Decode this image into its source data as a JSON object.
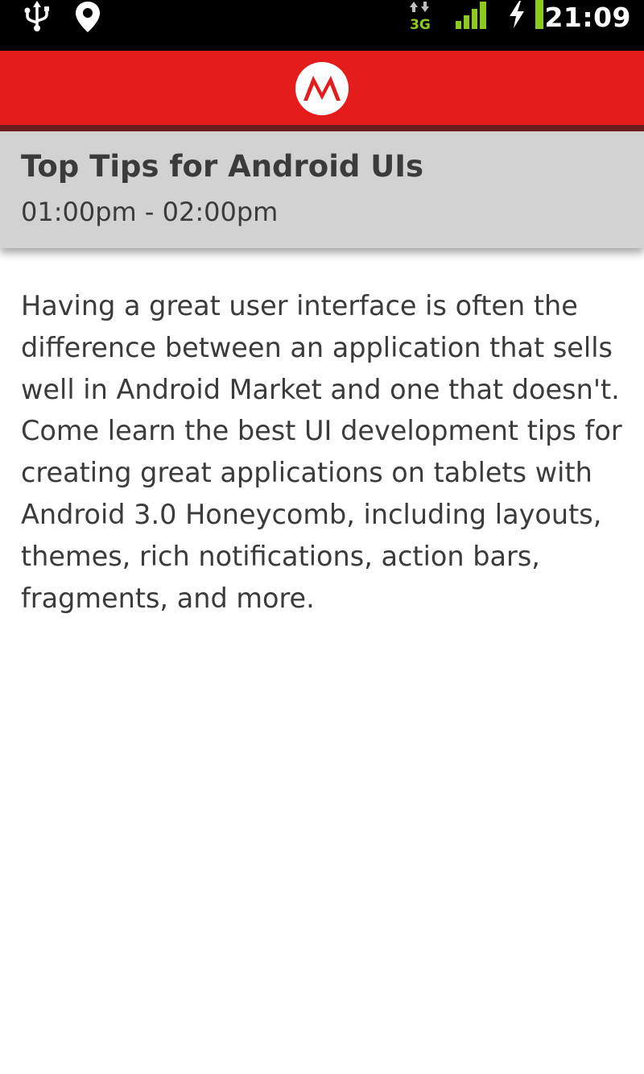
{
  "status_bar": {
    "time": "21:09",
    "network_label": "3G",
    "icons": [
      "usb-icon",
      "location-icon",
      "network-3g-icon",
      "signal-icon",
      "charging-icon",
      "battery-icon"
    ],
    "accent_color": "#8ccb1e"
  },
  "brand_bar": {
    "logo": "motorola-logo",
    "color": "#e41c1c"
  },
  "session": {
    "title": "Top Tips for Android UIs",
    "time_range": "01:00pm - 02:00pm",
    "description": "Having a great user interface is often the difference between an application that sells well in Android Market and one that doesn't. Come learn the best UI development tips for creating great applications on tablets with Android 3.0 Honeycomb, including layouts, themes, rich notifications, action bars, fragments, and more."
  }
}
